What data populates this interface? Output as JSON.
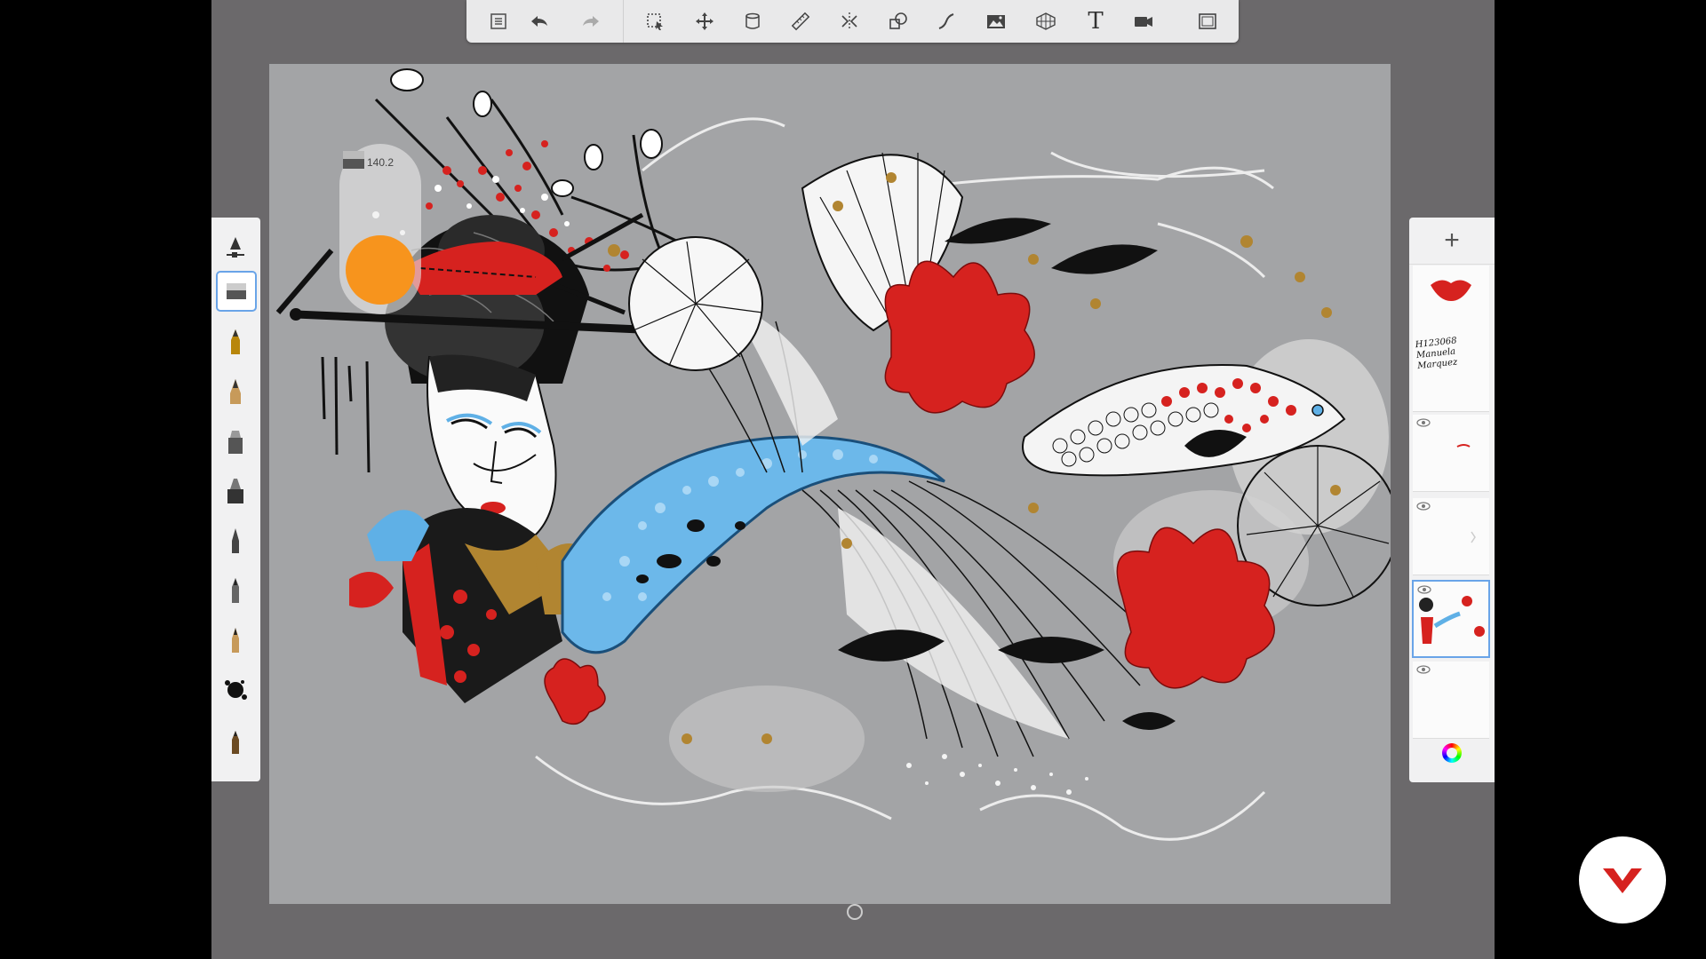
{
  "toolbar": {
    "items": [
      {
        "name": "menu-icon",
        "label": "Menu"
      },
      {
        "name": "undo-icon",
        "label": "Undo"
      },
      {
        "name": "redo-icon",
        "label": "Redo"
      },
      {
        "name": "selection-icon",
        "label": "Selection"
      },
      {
        "name": "transform-icon",
        "label": "Transform"
      },
      {
        "name": "copy-layer-icon",
        "label": "Copy"
      },
      {
        "name": "ruler-icon",
        "label": "Ruler"
      },
      {
        "name": "symmetry-icon",
        "label": "Symmetry"
      },
      {
        "name": "shapes-icon",
        "label": "Shapes"
      },
      {
        "name": "stroke-icon",
        "label": "Stroke"
      },
      {
        "name": "image-icon",
        "label": "Image"
      },
      {
        "name": "perspective-icon",
        "label": "Perspective"
      },
      {
        "name": "text-icon",
        "label": "Text"
      },
      {
        "name": "record-icon",
        "label": "Record"
      },
      {
        "name": "fullscreen-icon",
        "label": "Fullscreen"
      }
    ],
    "text_tool_glyph": "T"
  },
  "puck": {
    "brush_size": "140.2",
    "color": "#f7941d"
  },
  "brushes": [
    {
      "name": "brush-properties-icon"
    },
    {
      "name": "eraser-brush-icon",
      "selected": true
    },
    {
      "name": "pencil-brush-icon"
    },
    {
      "name": "ballpoint-brush-icon"
    },
    {
      "name": "marker-brush-icon"
    },
    {
      "name": "chisel-marker-icon"
    },
    {
      "name": "airbrush-icon"
    },
    {
      "name": "paint-brush-icon"
    },
    {
      "name": "ink-pen-icon"
    },
    {
      "name": "splatter-brush-icon"
    },
    {
      "name": "smudge-brush-icon"
    }
  ],
  "layers": {
    "add_label": "+",
    "items": [
      {
        "name": "layer-lips",
        "visible_eye": false,
        "text": ""
      },
      {
        "name": "layer-signature",
        "visible_eye": false,
        "text": "H123068 Manuela Marquez"
      },
      {
        "name": "layer-3",
        "visible_eye": true,
        "text": ""
      },
      {
        "name": "layer-4",
        "visible_eye": true,
        "text": ""
      },
      {
        "name": "layer-5",
        "visible_eye": true,
        "text": "",
        "selected": true
      },
      {
        "name": "layer-6",
        "visible_eye": true,
        "text": ""
      }
    ]
  },
  "colors": {
    "app_bg": "#6b696b",
    "canvas_bg": "#a3a4a6",
    "accent_blue": "#69a4e8",
    "paint_red": "#d6221f",
    "paint_blue": "#5fb0e6",
    "paint_gold": "#b18531"
  }
}
